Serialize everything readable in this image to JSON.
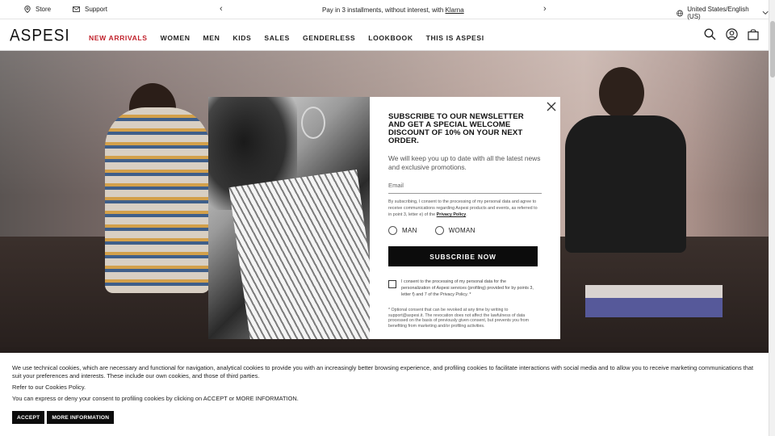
{
  "topbar": {
    "store_label": "Store",
    "support_label": "Support",
    "promo_text": "Pay in 3 installments, without interest, with ",
    "promo_link": "Klarna",
    "region_label": "United States/English (US)"
  },
  "nav": {
    "logo": "ASPESI",
    "items": [
      {
        "label": "NEW ARRIVALS"
      },
      {
        "label": "WOMEN"
      },
      {
        "label": "MEN"
      },
      {
        "label": "KIDS"
      },
      {
        "label": "SALES"
      },
      {
        "label": "GENDERLESS"
      },
      {
        "label": "LOOKBOOK"
      },
      {
        "label": "THIS IS ASPESI"
      }
    ],
    "accent_color": "#c0202a",
    "icons": [
      "search-icon",
      "account-icon",
      "bag-icon"
    ]
  },
  "modal": {
    "title": "SUBSCRIBE TO OUR NEWSLETTER AND GET A SPECIAL WELCOME DISCOUNT OF 10% ON YOUR NEXT ORDER.",
    "subtitle": "We will keep you up to date with all the latest news and exclusive promotions.",
    "email_placeholder": "Email",
    "consent_text": "By subscribing, I consent to the processing of my personal data and agree to receive communications regarding Aspesi products and events, as referred to in point 3, letter e) of the ",
    "privacy_link": "Privacy Policy",
    "consent_end": ".",
    "gender_options": [
      "MAN",
      "WOMAN"
    ],
    "subscribe_label": "SUBSCRIBE NOW",
    "profiling_text": "I consent to the processing of my personal data for the personalization of Aspesi services (profiling) provided for by points 3, letter f) and 7 of the Privacy Policy. *",
    "optional_note": "* Optional consent that can be revoked at any time by writing to support@aspesi.it. The revocation does not affect the lawfulness of data processed on the basis of previously given consent, but prevents you from benefiting from marketing and/or profiling activities."
  },
  "cookie_banner": {
    "line1": "We use technical cookies, which are necessary and functional for navigation, analytical cookies to provide you with an increasingly better browsing experience, and profiling cookies to facilitate interactions with social media and to allow you to receive marketing communications that suit your preferences and interests. These include our own cookies, and those of third parties.",
    "line2": "Refer to our Cookies Policy.",
    "line3": "You can express or deny your consent to profiling cookies by clicking on ACCEPT or MORE INFORMATION.",
    "accept_label": "ACCEPT",
    "more_label": "MORE INFORMATION"
  }
}
